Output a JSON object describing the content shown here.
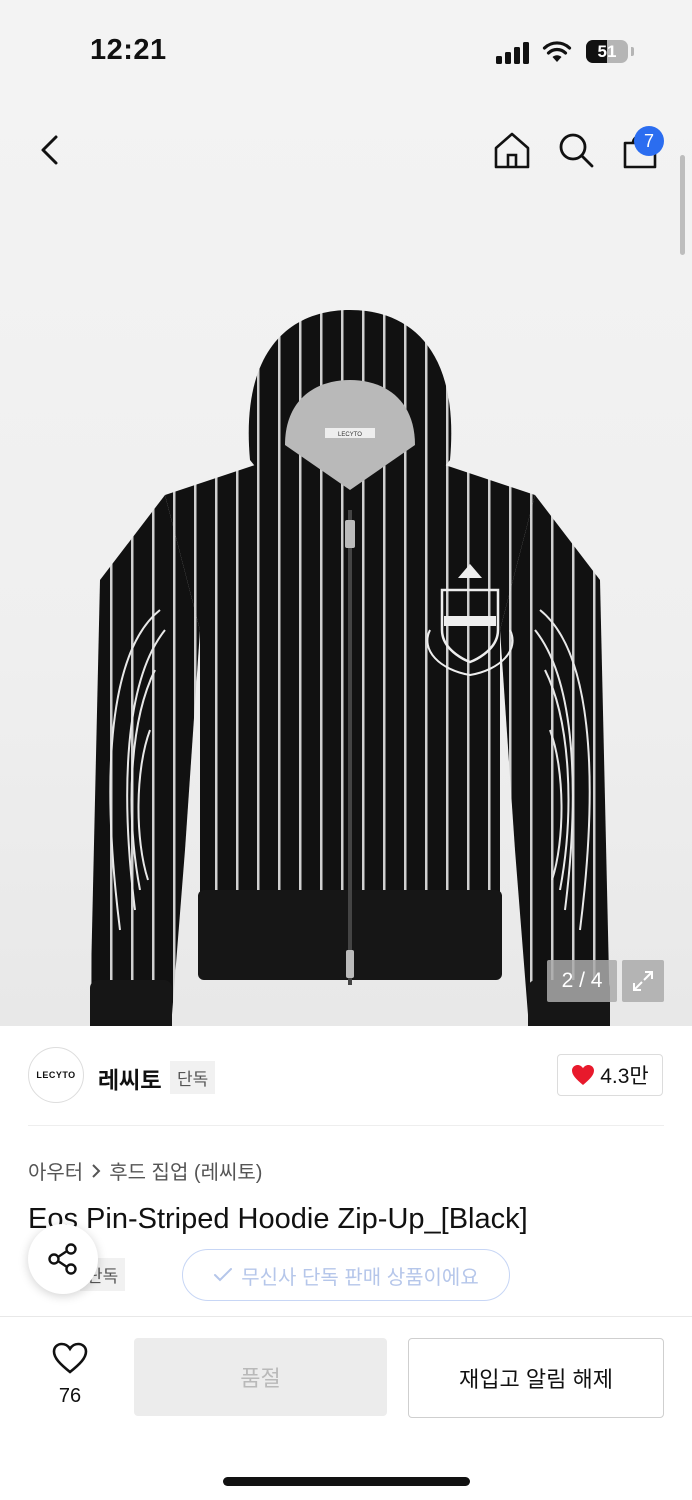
{
  "status_bar": {
    "time": "12:21",
    "battery": "51",
    "battery_level": 0.51
  },
  "nav": {
    "back_icon": "chevron-left-icon",
    "home_icon": "home-icon",
    "search_icon": "search-icon",
    "cart_icon": "shopping-bag-icon",
    "cart_badge": "7"
  },
  "gallery": {
    "counter": "2 / 4",
    "expand_icon": "expand-icon"
  },
  "hoodie_logo_text": "LECYTO",
  "brand": {
    "logo_text": "LECYTO",
    "name": "레씨토",
    "tag": "단독",
    "likes": "4.3만",
    "heart_color": "#e8192c"
  },
  "breadcrumb": {
    "category": "아우터",
    "subcategory": "후드 집업 (레씨토)"
  },
  "product": {
    "title": "Eos Pin-Striped Hoodie Zip-Up_[Black]",
    "tag": "단독",
    "exclusive_text": "무신사 단독 판매 상품이에요"
  },
  "bottom_bar": {
    "wish_count": "76",
    "soldout_label": "품절",
    "restock_label": "재입고 알림 해제"
  },
  "colors": {
    "accent_blue": "#2b6df0",
    "heart_red": "#e8192c"
  }
}
